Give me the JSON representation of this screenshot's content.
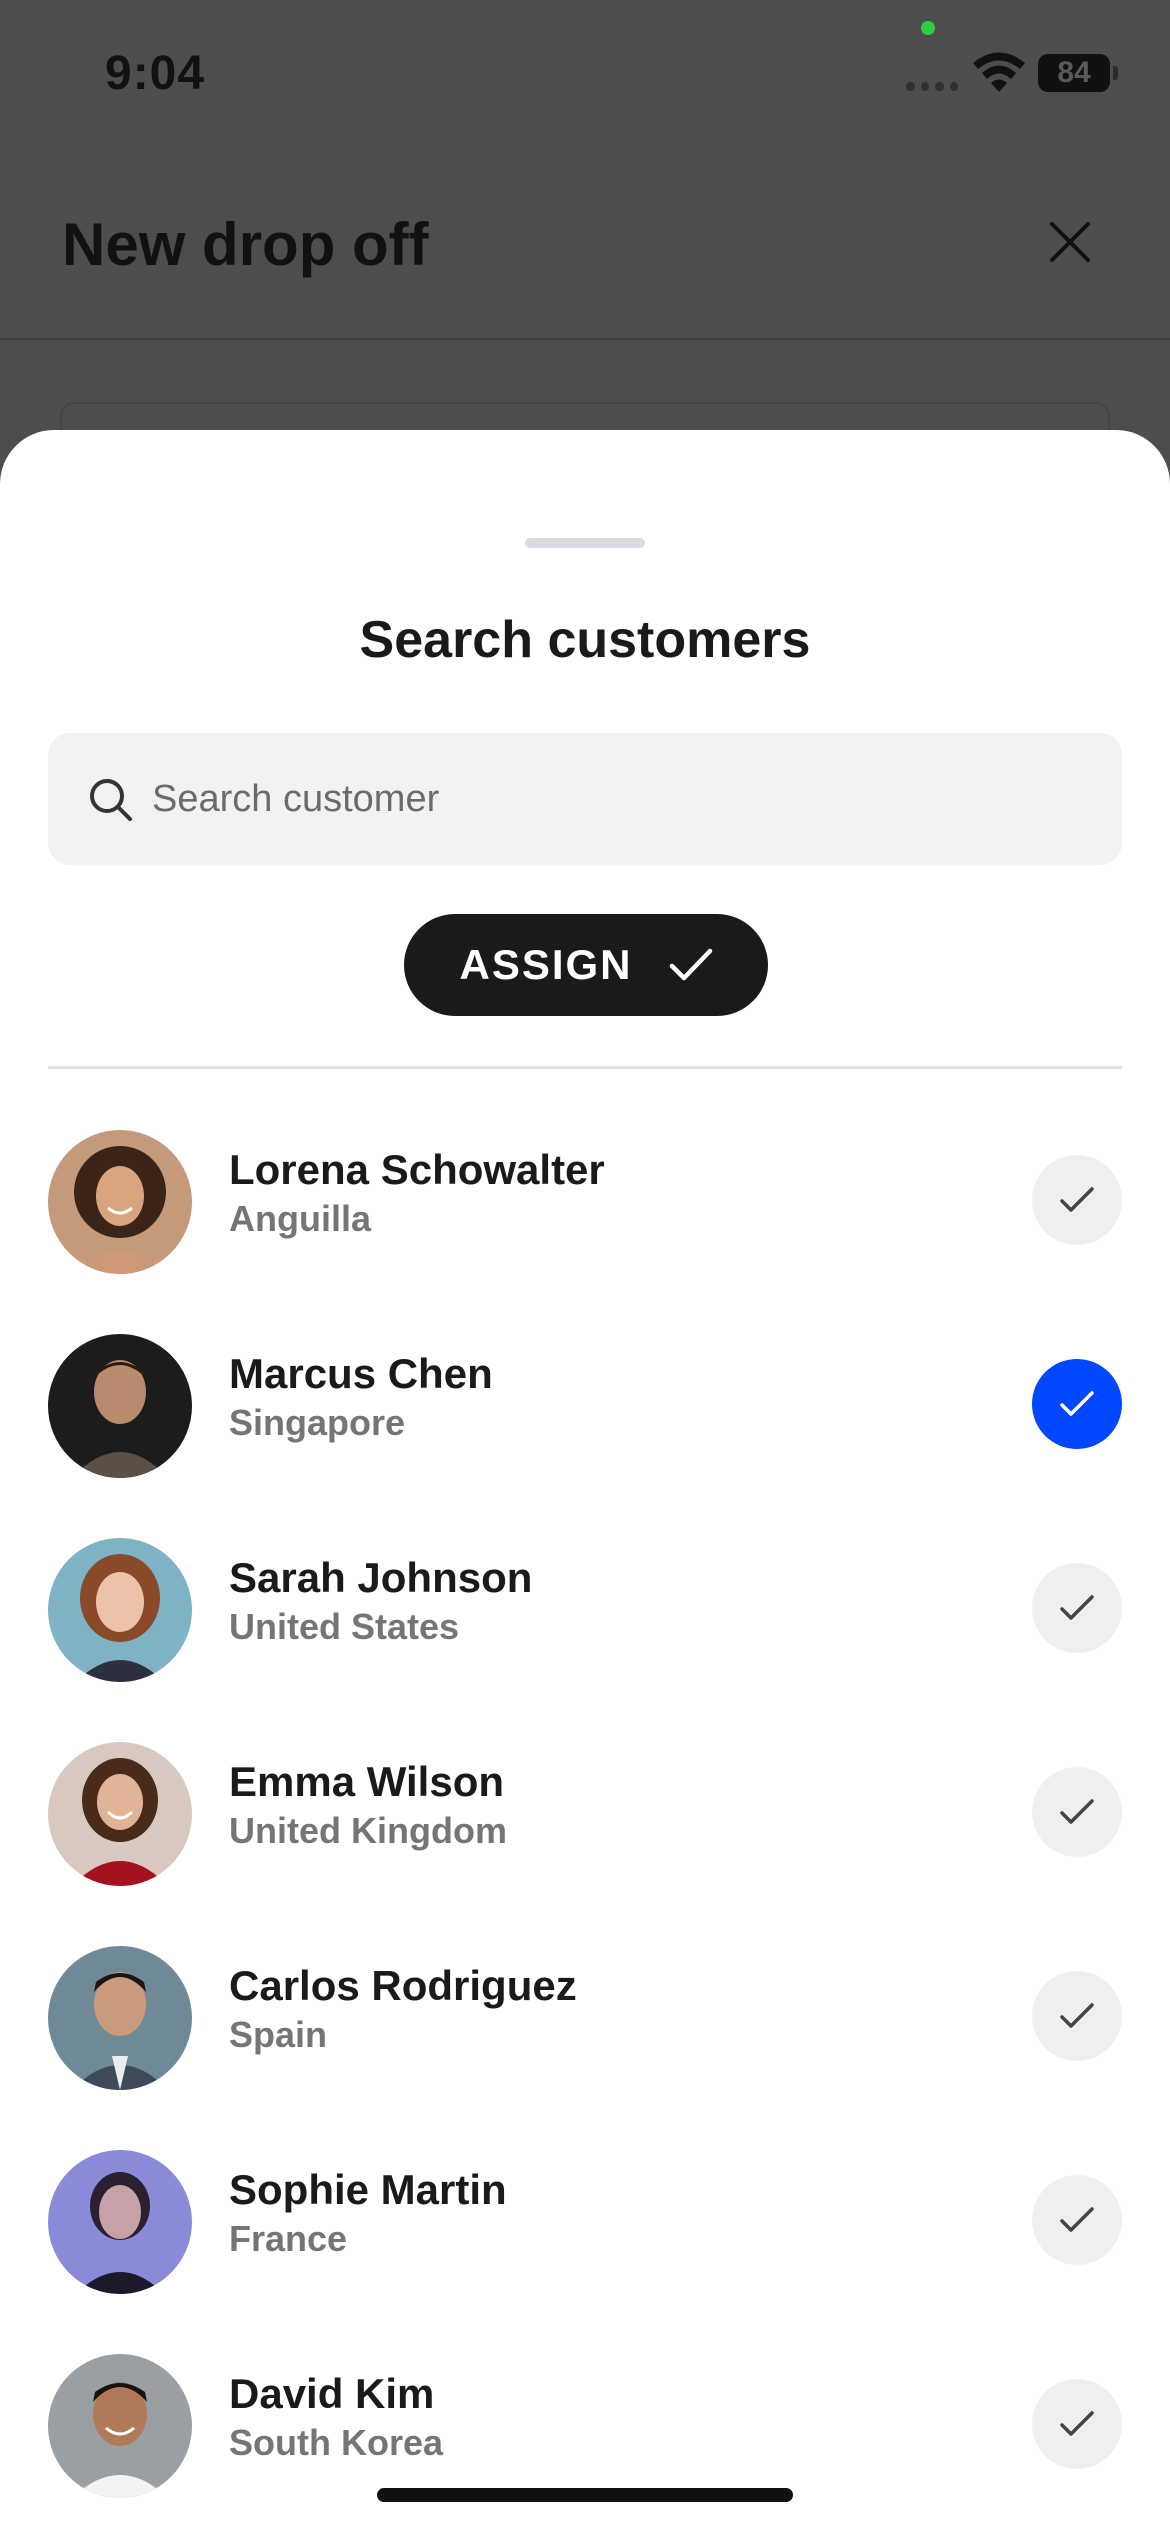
{
  "status_bar": {
    "time": "9:04",
    "battery": "84"
  },
  "background": {
    "title": "New drop off"
  },
  "sheet": {
    "title": "Search customers",
    "search": {
      "placeholder": "Search customer",
      "value": ""
    },
    "assign_label": "ASSIGN"
  },
  "customers": [
    {
      "name": "Lorena Schowalter",
      "country": "Anguilla",
      "selected": false
    },
    {
      "name": "Marcus Chen",
      "country": "Singapore",
      "selected": true
    },
    {
      "name": "Sarah Johnson",
      "country": "United States",
      "selected": false
    },
    {
      "name": "Emma Wilson",
      "country": "United Kingdom",
      "selected": false
    },
    {
      "name": "Carlos Rodriguez",
      "country": "Spain",
      "selected": false
    },
    {
      "name": "Sophie Martin",
      "country": "France",
      "selected": false
    },
    {
      "name": "David Kim",
      "country": "South Korea",
      "selected": false
    }
  ],
  "colors": {
    "accent": "#0047ff",
    "button_dark": "#1a1a1a",
    "check_idle": "#efefef",
    "overlay": "#4d4d4d"
  }
}
